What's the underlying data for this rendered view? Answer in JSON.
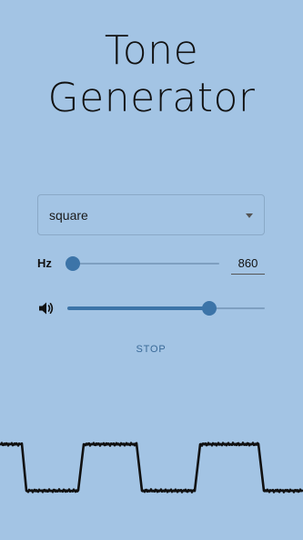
{
  "app": {
    "title_line1": "Tone",
    "title_line2": "Generator"
  },
  "waveform_select": {
    "value": "square"
  },
  "frequency": {
    "label": "Hz",
    "value": "860",
    "slider_fraction": 0.05
  },
  "volume": {
    "icon": "volume-icon",
    "slider_fraction": 0.72
  },
  "controls": {
    "stop_label": "STOP"
  },
  "waveform_display": {
    "shape": "square"
  },
  "colors": {
    "background": "#a3c4e4",
    "accent": "#3c74a8",
    "button_text": "#3a6a98"
  }
}
